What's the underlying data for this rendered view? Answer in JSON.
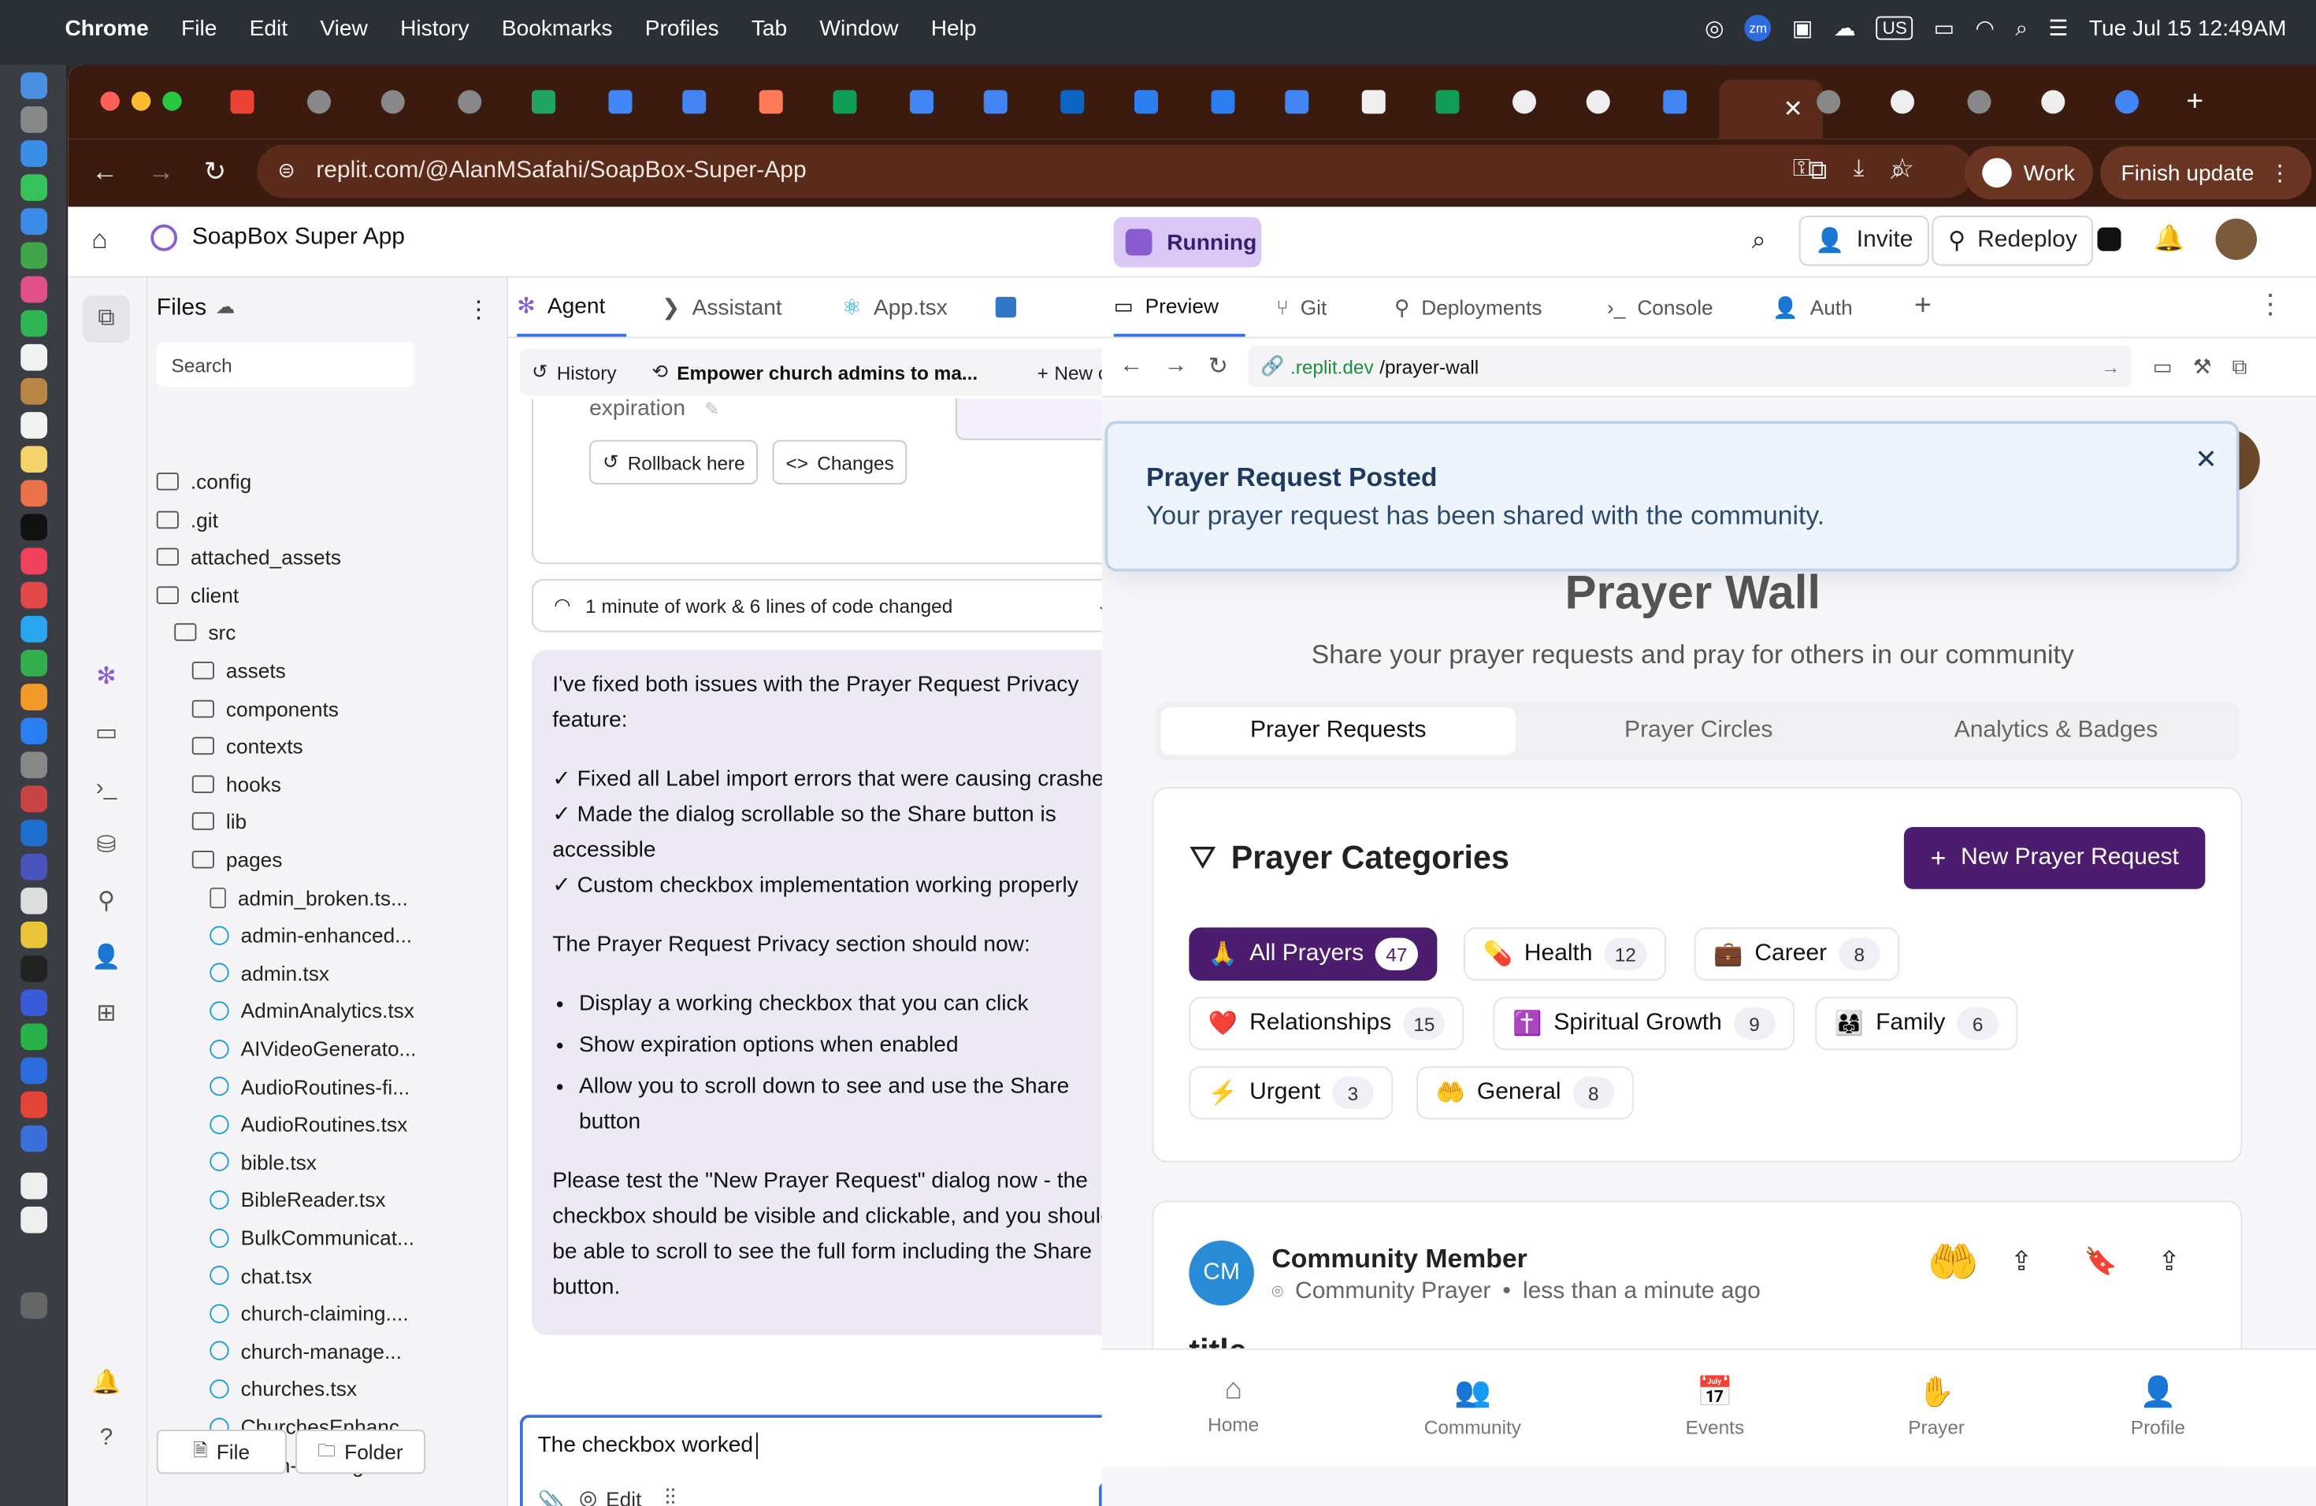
{
  "menubar": {
    "app": "Chrome",
    "items": [
      "File",
      "Edit",
      "View",
      "History",
      "Bookmarks",
      "Profiles",
      "Tab",
      "Window",
      "Help"
    ],
    "input_source": "US",
    "clock": "Tue Jul 15  12:49AM"
  },
  "browser": {
    "url": "replit.com/@AlanMSafahi/SoapBox-Super-App",
    "profile_label": "Work",
    "update_label": "Finish update"
  },
  "replit": {
    "project_name": "SoapBox Super App",
    "run_status": "Running",
    "invite_label": "Invite",
    "redeploy_label": "Redeploy"
  },
  "files": {
    "title": "Files",
    "search_placeholder": "Search",
    "items": [
      {
        "name": ".config",
        "type": "folder"
      },
      {
        "name": ".git",
        "type": "folder"
      },
      {
        "name": "attached_assets",
        "type": "folder"
      },
      {
        "name": "client",
        "type": "folder"
      },
      {
        "name": "src",
        "type": "folder"
      },
      {
        "name": "assets",
        "type": "folder"
      },
      {
        "name": "components",
        "type": "folder"
      },
      {
        "name": "contexts",
        "type": "folder"
      },
      {
        "name": "hooks",
        "type": "folder"
      },
      {
        "name": "lib",
        "type": "folder"
      },
      {
        "name": "pages",
        "type": "folder"
      },
      {
        "name": "admin_broken.ts...",
        "type": "file"
      },
      {
        "name": "admin-enhanced...",
        "type": "react"
      },
      {
        "name": "admin.tsx",
        "type": "react"
      },
      {
        "name": "AdminAnalytics.tsx",
        "type": "react"
      },
      {
        "name": "AIVideoGenerato...",
        "type": "react"
      },
      {
        "name": "AudioRoutines-fi...",
        "type": "react"
      },
      {
        "name": "AudioRoutines.tsx",
        "type": "react"
      },
      {
        "name": "bible.tsx",
        "type": "react"
      },
      {
        "name": "BibleReader.tsx",
        "type": "react"
      },
      {
        "name": "BulkCommunicat...",
        "type": "react"
      },
      {
        "name": "chat.tsx",
        "type": "react"
      },
      {
        "name": "church-claiming....",
        "type": "react"
      },
      {
        "name": "church-manage...",
        "type": "react"
      },
      {
        "name": "churches.tsx",
        "type": "react"
      },
      {
        "name": "ChurchesEnhanc...",
        "type": "react"
      },
      {
        "name": "clean-landing.tsx",
        "type": "react"
      }
    ],
    "new_file_label": "File",
    "new_folder_label": "Folder"
  },
  "agent": {
    "tabs": [
      "Agent",
      "Assistant",
      "App.tsx"
    ],
    "history_label": "History",
    "chat_title": "Empower church admins to ma...",
    "new_chat_label": "New chat",
    "prev_snippet": "expiration",
    "rollback_label": "Rollback here",
    "changes_label": "Changes",
    "work_summary": "1 minute of work & 6 lines of code changed",
    "message": {
      "intro": "I've fixed both issues with the Prayer Request Privacy feature:",
      "checks": [
        "✓ Fixed all Label import errors that were causing crashes",
        "✓ Made the dialog scrollable so the Share button is accessible",
        "✓ Custom checkbox implementation working properly"
      ],
      "lead": "The Prayer Request Privacy section should now:",
      "bullets": [
        "Display a working checkbox that you can click",
        "Show expiration options when enabled",
        "Allow you to scroll down to see and use the Share button"
      ],
      "closing": "Please test the \"New Prayer Request\" dialog now - the checkbox should be visible and clickable, and you should be able to scroll to see the full form including the Share button."
    },
    "input_value": "The checkbox worked",
    "edit_label": "Edit"
  },
  "preview": {
    "tabs": [
      "Preview",
      "Git",
      "Deployments",
      "Console",
      "Auth"
    ],
    "url_domain": ".replit.dev",
    "url_path": "/prayer-wall",
    "toast": {
      "title": "Prayer Request Posted",
      "body": "Your prayer request has been shared with the community."
    },
    "page_title": "Prayer Wall",
    "subtitle": "Share your prayer requests and pray for others in our community",
    "seg_tabs": [
      "Prayer Requests",
      "Prayer Circles",
      "Analytics & Badges"
    ],
    "categories_title": "Prayer Categories",
    "new_request_label": "New Prayer Request",
    "categories": [
      {
        "emoji": "🙏",
        "name": "All Prayers",
        "count": "47"
      },
      {
        "emoji": "💊",
        "name": "Health",
        "count": "12"
      },
      {
        "emoji": "💼",
        "name": "Career",
        "count": "8"
      },
      {
        "emoji": "❤️",
        "name": "Relationships",
        "count": "15"
      },
      {
        "emoji": "✝️",
        "name": "Spiritual Growth",
        "count": "9"
      },
      {
        "emoji": "👨‍👩‍👧",
        "name": "Family",
        "count": "6"
      },
      {
        "emoji": "⚡",
        "name": "Urgent",
        "count": "3"
      },
      {
        "emoji": "🤲",
        "name": "General",
        "count": "8"
      }
    ],
    "post": {
      "avatar": "CM",
      "author": "Community Member",
      "group": "Community Prayer",
      "time": "less than a minute ago",
      "title_partial": "title"
    },
    "bottom_nav": [
      "Home",
      "Community",
      "Events",
      "Prayer",
      "Profile"
    ]
  },
  "colors": {
    "brand_purple": "#4c1d6e",
    "running_bg": "#d9c8f5",
    "tab_bar": "#3b1a10"
  }
}
